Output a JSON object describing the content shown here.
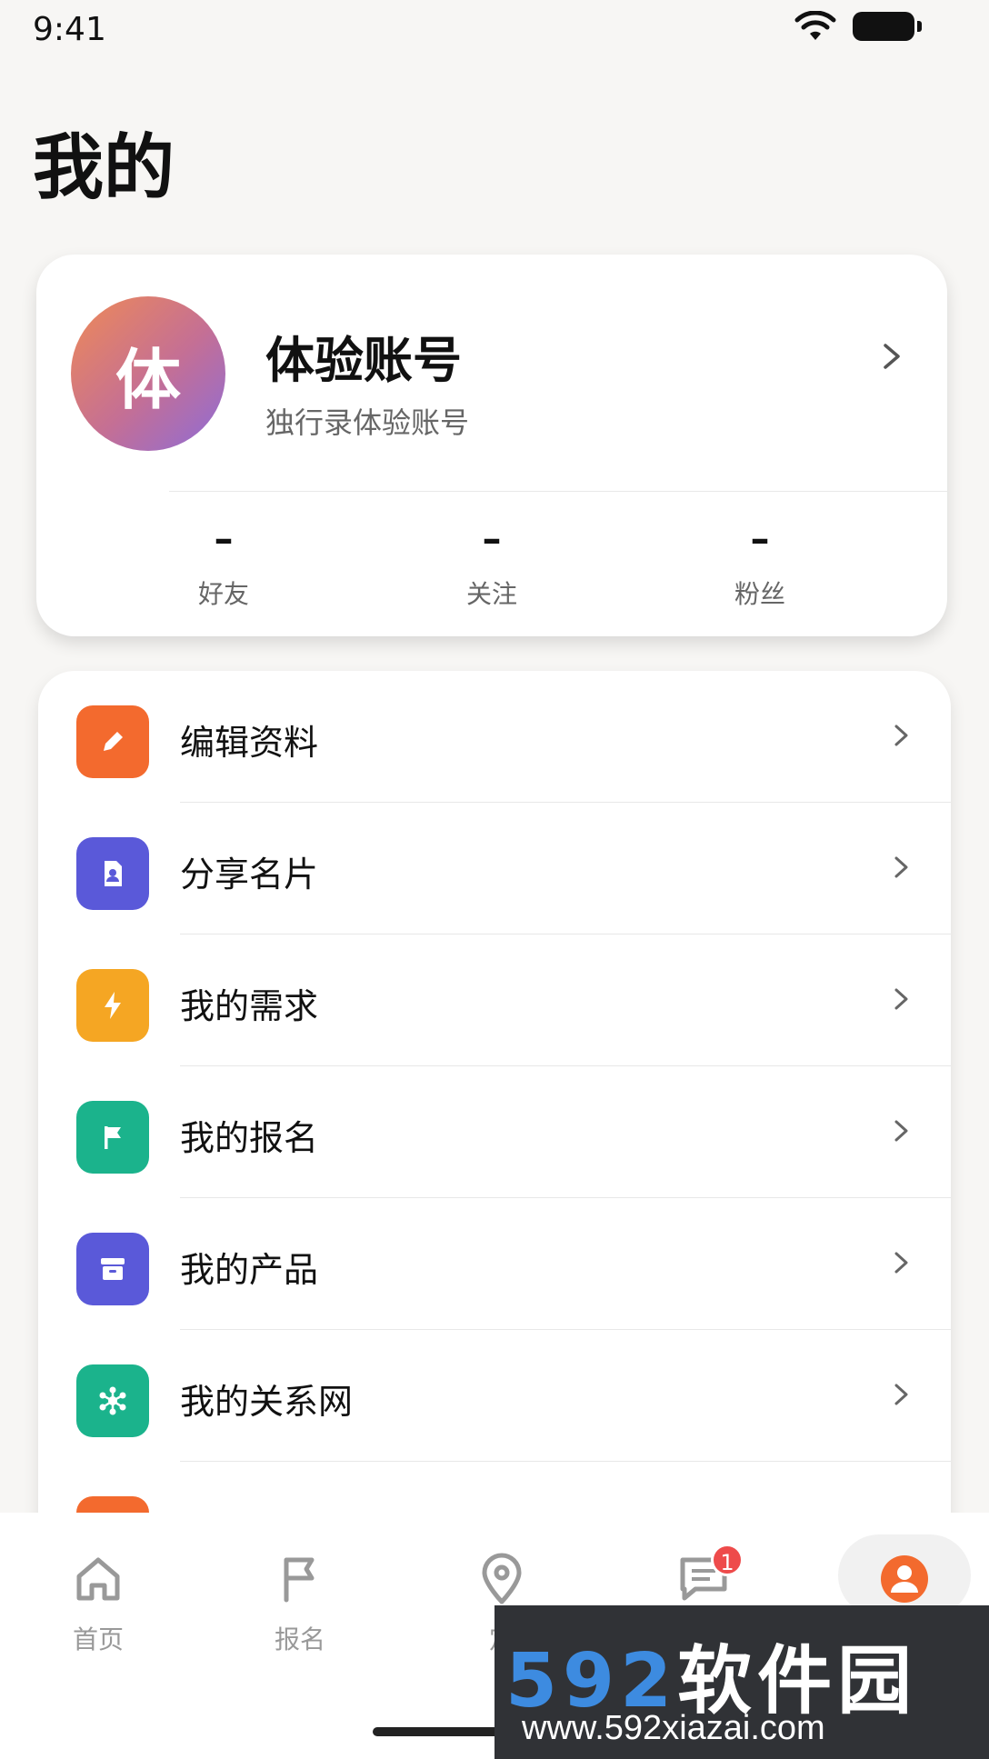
{
  "status": {
    "time": "9:41"
  },
  "page": {
    "title": "我的"
  },
  "profile": {
    "avatar_char": "体",
    "name": "体验账号",
    "subtitle": "独行录体验账号",
    "stats": [
      {
        "value": "–",
        "label": "好友"
      },
      {
        "value": "–",
        "label": "关注"
      },
      {
        "value": "–",
        "label": "粉丝"
      }
    ]
  },
  "menu": [
    {
      "label": "编辑资料",
      "icon": "edit-icon",
      "color": "#f36a2e"
    },
    {
      "label": "分享名片",
      "icon": "card-icon",
      "color": "#5a59d9"
    },
    {
      "label": "我的需求",
      "icon": "lightning-icon",
      "color": "#f5a623"
    },
    {
      "label": "我的报名",
      "icon": "flag-icon",
      "color": "#1bb38c"
    },
    {
      "label": "我的产品",
      "icon": "archive-icon",
      "color": "#5a59d9"
    },
    {
      "label": "我的关系网",
      "icon": "network-icon",
      "color": "#1bb38c"
    },
    {
      "label": "",
      "icon": "partial-icon",
      "color": "#f36a2e"
    }
  ],
  "nav": [
    {
      "label": "首页",
      "icon": "home-icon"
    },
    {
      "label": "报名",
      "icon": "flag-icon"
    },
    {
      "label": "定",
      "icon": "location-icon"
    },
    {
      "label": "",
      "icon": "message-icon",
      "badge": "1"
    },
    {
      "label": "",
      "icon": "profile-icon"
    }
  ],
  "watermark": {
    "brand_num": "592",
    "brand_text": "软件园",
    "url": "www.592xiazai.com"
  }
}
